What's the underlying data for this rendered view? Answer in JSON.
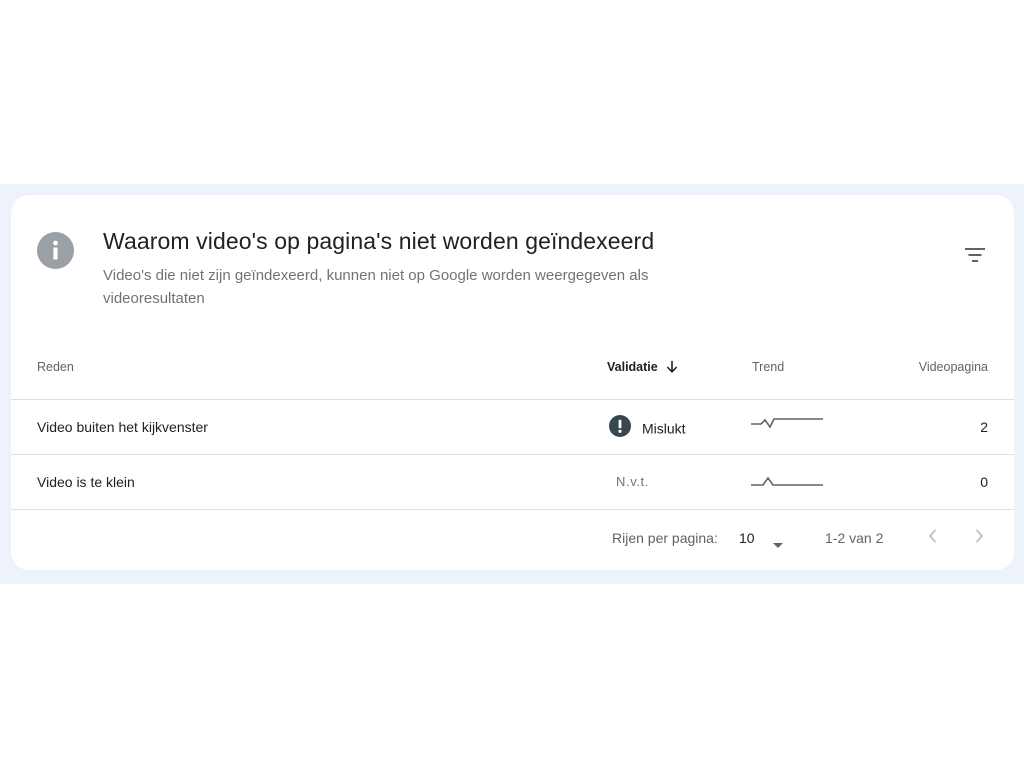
{
  "header": {
    "title": "Waarom video's op pagina's niet worden geïndexeerd",
    "subtitle": "Video's die niet zijn geïndexeerd, kunnen niet op Google worden weergegeven als videoresultaten",
    "icon": "info-icon",
    "filter_icon": "filter-icon"
  },
  "table": {
    "columns": {
      "reason": "Reden",
      "validation": "Validatie",
      "trend": "Trend",
      "pages": "Videopagina"
    },
    "sort_column": "validation",
    "sort_direction": "descending",
    "rows": [
      {
        "reason": "Video buiten het kijkvenster",
        "validation": "Mislukt",
        "validation_icon": "exclamation-icon",
        "pages": "2"
      },
      {
        "reason": "Video is te klein",
        "validation": "N.v.t.",
        "pages": "0"
      }
    ]
  },
  "footer": {
    "rows_per_page_label": "Rijen per pagina:",
    "rows_per_page_value": "10",
    "range": "1-2 van 2"
  },
  "colors": {
    "band_background": "#eef2fb",
    "card_background": "#ffffff",
    "info_icon": "#9aa0a6",
    "failed_badge": "#37474f",
    "sparkline": "#5f6368"
  }
}
